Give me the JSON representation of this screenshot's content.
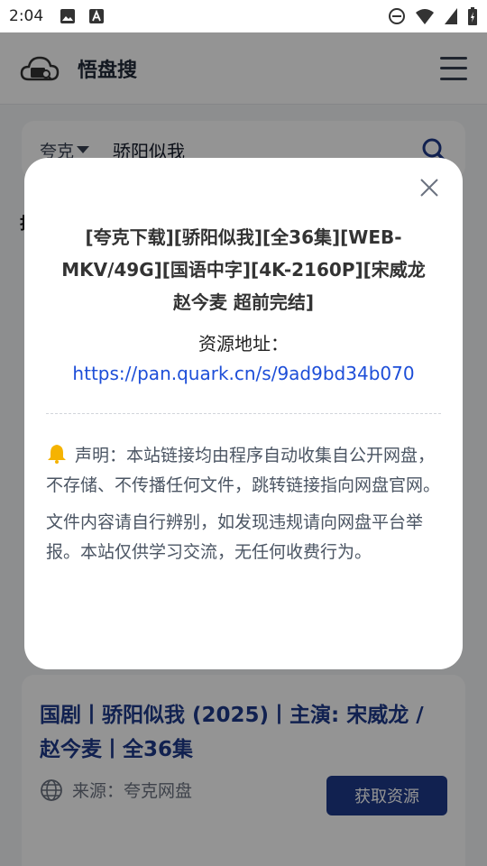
{
  "status_bar": {
    "time": "2:04"
  },
  "app": {
    "title": "悟盘搜"
  },
  "search": {
    "type": "夸克",
    "query": "骄阳似我"
  },
  "page": {
    "side_char": "找"
  },
  "result": {
    "title": "国剧丨骄阳似我 (2025)丨主演: 宋威龙 / 赵今麦丨全36集",
    "source": "来源：夸克网盘",
    "button": "获取资源"
  },
  "modal": {
    "title": "[夸克下载][骄阳似我][全36集][WEB-MKV/49G][国语中字][4K-2160P][宋威龙 赵今麦 超前完结]",
    "address_label": "资源地址：",
    "link": "https://pan.quark.cn/s/9ad9bd34b070",
    "notice_1": "声明：本站链接均由程序自动收集自公开网盘，不存储、不传播任何文件，跳转链接指向网盘官网。",
    "notice_2": "文件内容请自行辨别，如发现违规请向网盘平台举报。本站仅供学习交流，无任何收费行为。"
  },
  "colors": {
    "accent": "#1e3a8a",
    "link": "#1d4ed8"
  }
}
